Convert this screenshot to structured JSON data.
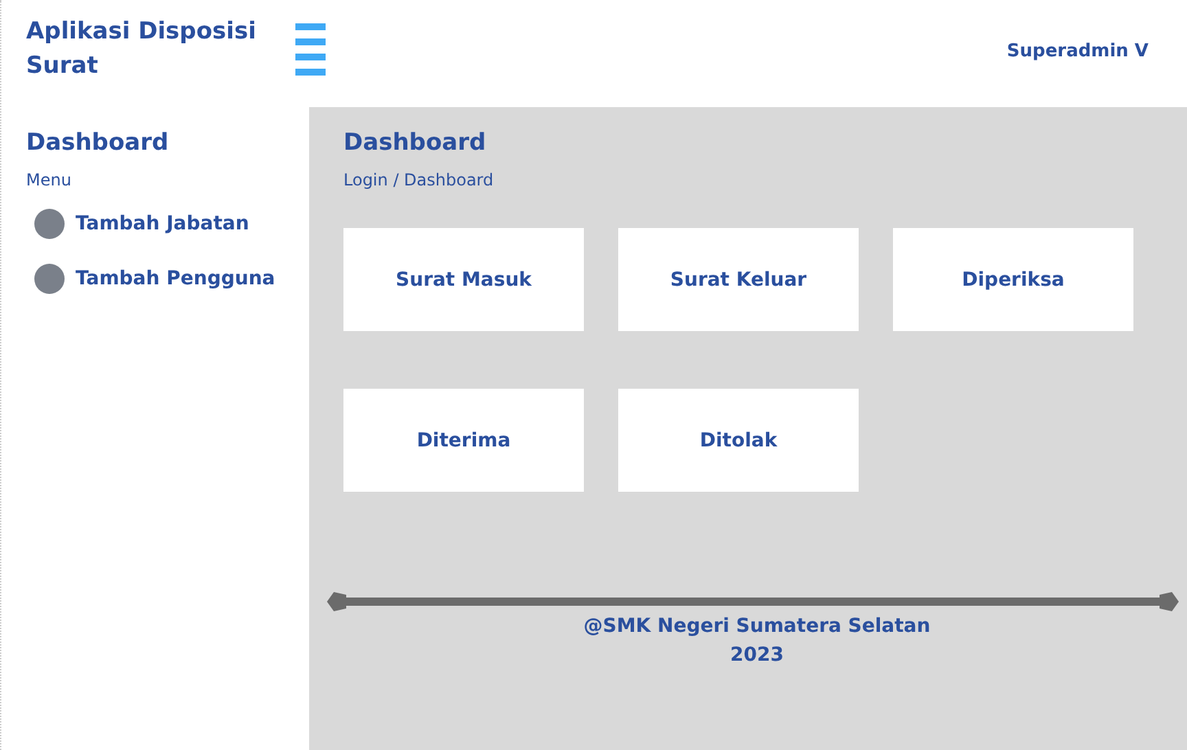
{
  "app_title": "Aplikasi Disposisi Surat",
  "user": "Superadmin V",
  "sidebar": {
    "title": "Dashboard",
    "section": "Menu",
    "items": [
      {
        "label": "Tambah Jabatan"
      },
      {
        "label": "Tambah Pengguna"
      }
    ]
  },
  "main": {
    "title": "Dashboard",
    "breadcrumb": "Login / Dashboard",
    "cards": [
      {
        "label": "Surat Masuk"
      },
      {
        "label": "Surat Keluar"
      },
      {
        "label": "Diperiksa"
      },
      {
        "label": "Diterima"
      },
      {
        "label": "Ditolak"
      }
    ]
  },
  "footer": [
    "@SMK Negeri Sumatera Selatan",
    "2023"
  ]
}
